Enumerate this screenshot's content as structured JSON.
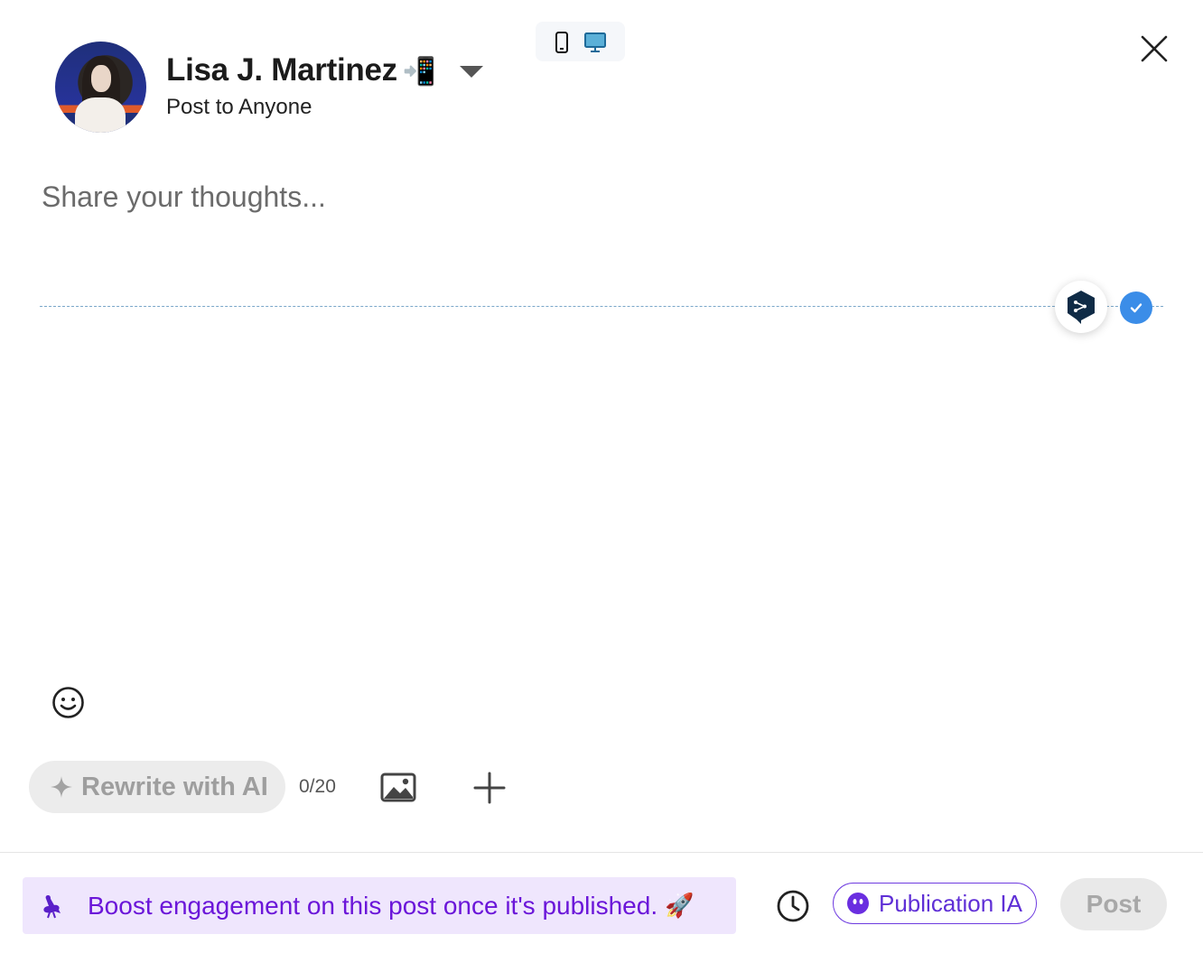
{
  "header": {
    "user_name": "Lisa J. Martinez",
    "name_emoji": "📲",
    "audience": "Post to Anyone"
  },
  "device_toggle": {
    "options": [
      "mobile-preview",
      "desktop-preview"
    ],
    "selected": "desktop-preview"
  },
  "editor": {
    "placeholder": "Share your thoughts..."
  },
  "toolbar": {
    "rewrite_label": "Rewrite with AI",
    "counter": "0/20"
  },
  "footer": {
    "boost_text": "Boost engagement on this post once it's published.",
    "boost_emoji": "🚀",
    "publication_label": "Publication IA",
    "post_label": "Post"
  },
  "colors": {
    "accent_purple": "#6b16d9",
    "banner_bg": "#efe6fd",
    "check_blue": "#3b8de8",
    "disabled_grey": "#a8a8a8"
  },
  "icons": [
    "phone-icon",
    "desktop-icon",
    "close-icon",
    "deepl-icon",
    "check-icon",
    "emoji-icon",
    "sparkle-icon",
    "image-icon",
    "plus-icon",
    "ostrich-icon",
    "rocket-icon",
    "clock-icon",
    "ai-face-icon"
  ]
}
